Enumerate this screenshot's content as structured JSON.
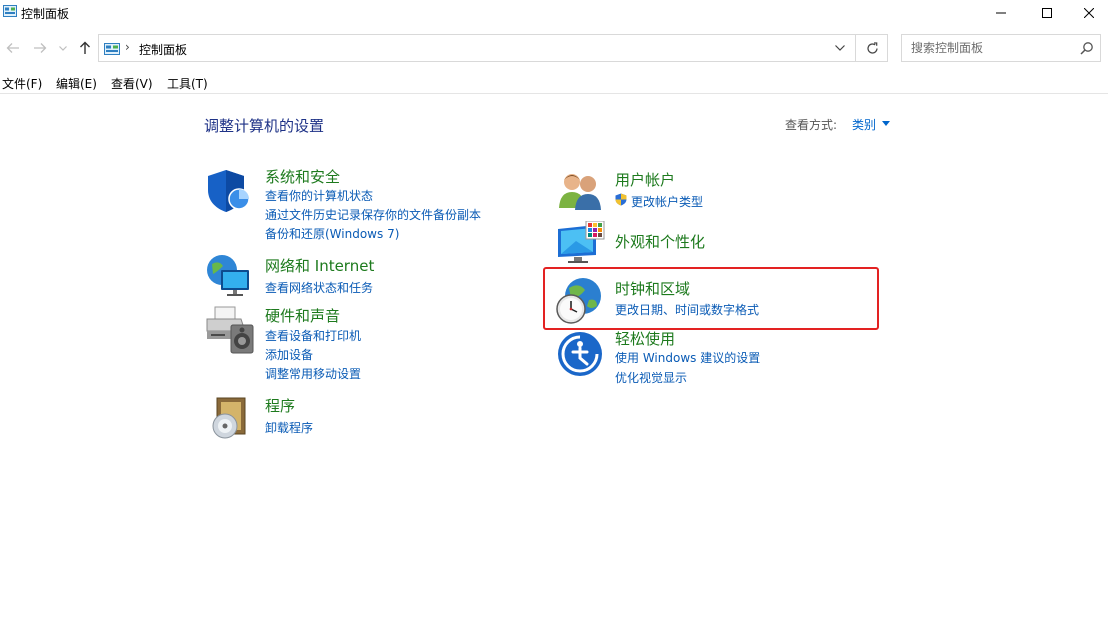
{
  "window": {
    "title": "控制面板",
    "icons": {
      "app": "control-panel-icon",
      "minimize": "minimize-icon",
      "maximize": "maximize-icon",
      "close": "close-icon"
    }
  },
  "navigation": {
    "address_path": "控制面板",
    "search_placeholder": "搜索控制面板",
    "icons": {
      "back": "arrow-left-icon",
      "forward": "arrow-right-icon",
      "recent": "chevron-down-icon",
      "up": "arrow-up-icon",
      "refresh": "refresh-icon",
      "search": "search-icon"
    }
  },
  "menu": {
    "items": [
      "文件(F)",
      "编辑(E)",
      "查看(V)",
      "工具(T)"
    ]
  },
  "content": {
    "heading": "调整计算机的设置",
    "view_by_label": "查看方式:",
    "view_by_value": "类别",
    "left_categories": [
      {
        "title": "系统和安全",
        "icon": "shield-icon",
        "links": [
          "查看你的计算机状态",
          "通过文件历史记录保存你的文件备份副本",
          "备份和还原(Windows 7)"
        ]
      },
      {
        "title": "网络和 Internet",
        "icon": "network-globe-icon",
        "links": [
          "查看网络状态和任务"
        ]
      },
      {
        "title": "硬件和声音",
        "icon": "printer-speaker-icon",
        "links": [
          "查看设备和打印机",
          "添加设备",
          "调整常用移动设置"
        ]
      },
      {
        "title": "程序",
        "icon": "programs-disc-icon",
        "links": [
          "卸载程序"
        ]
      }
    ],
    "right_categories": [
      {
        "title": "用户帐户",
        "icon": "users-icon",
        "links": [
          "更改帐户类型"
        ],
        "link_icon": "uac-shield-icon"
      },
      {
        "title": "外观和个性化",
        "icon": "monitor-palette-icon",
        "links": []
      },
      {
        "title": "时钟和区域",
        "icon": "clock-globe-icon",
        "links": [
          "更改日期、时间或数字格式"
        ],
        "highlighted": true
      },
      {
        "title": "轻松使用",
        "icon": "accessibility-icon",
        "links": [
          "使用 Windows 建议的设置",
          "优化视觉显示"
        ]
      }
    ]
  },
  "colors": {
    "heading": "#1e3287",
    "category_title": "#1d7a1d",
    "link": "#0a5bb5",
    "highlight_border": "#e32222"
  }
}
